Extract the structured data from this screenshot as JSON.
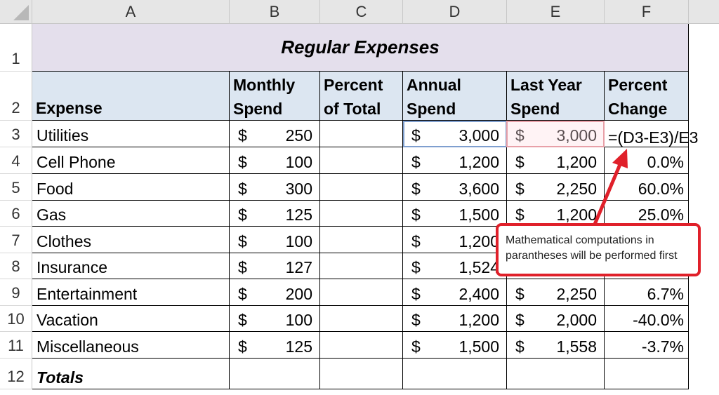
{
  "columns": [
    "A",
    "B",
    "C",
    "D",
    "E",
    "F"
  ],
  "rows": [
    "1",
    "2",
    "3",
    "4",
    "5",
    "6",
    "7",
    "8",
    "9",
    "10",
    "11",
    "12"
  ],
  "title": "Regular Expenses",
  "headers": {
    "a": "Expense",
    "b1": "Monthly",
    "b2": "Spend",
    "c1": "Percent",
    "c2": "of Total",
    "d1": "Annual",
    "d2": "Spend",
    "e1": "Last Year",
    "e2": "Spend",
    "f1": "Percent",
    "f2": "Change"
  },
  "currency_symbol": "$",
  "data_rows": [
    {
      "expense": "Utilities",
      "monthly": "250",
      "annual": "3,000",
      "last_year": "3,000",
      "change": ""
    },
    {
      "expense": "Cell Phone",
      "monthly": "100",
      "annual": "1,200",
      "last_year": "1,200",
      "change": "0.0%"
    },
    {
      "expense": "Food",
      "monthly": "300",
      "annual": "3,600",
      "last_year": "2,250",
      "change": "60.0%"
    },
    {
      "expense": "Gas",
      "monthly": "125",
      "annual": "1,500",
      "last_year": "1,200",
      "change": "25.0%"
    },
    {
      "expense": "Clothes",
      "monthly": "100",
      "annual": "1,200",
      "last_year": "",
      "change": ""
    },
    {
      "expense": "Insurance",
      "monthly": "127",
      "annual": "1,524",
      "last_year": "",
      "change": ""
    },
    {
      "expense": "Entertainment",
      "monthly": "200",
      "annual": "2,400",
      "last_year": "2,250",
      "change": "6.7%"
    },
    {
      "expense": "Vacation",
      "monthly": "100",
      "annual": "1,200",
      "last_year": "2,000",
      "change": "-40.0%"
    },
    {
      "expense": "Miscellaneous",
      "monthly": "125",
      "annual": "1,500",
      "last_year": "1,558",
      "change": "-3.7%"
    }
  ],
  "totals_label": "Totals",
  "formula_text": "=(D3-E3)/E3",
  "callout_text": "Mathematical computations in parantheses will be performed first",
  "colors": {
    "title_fill": "#e4dfec",
    "header_fill": "#dce6f1",
    "callout_border": "#e0202a",
    "arrow": "#e0202a"
  }
}
